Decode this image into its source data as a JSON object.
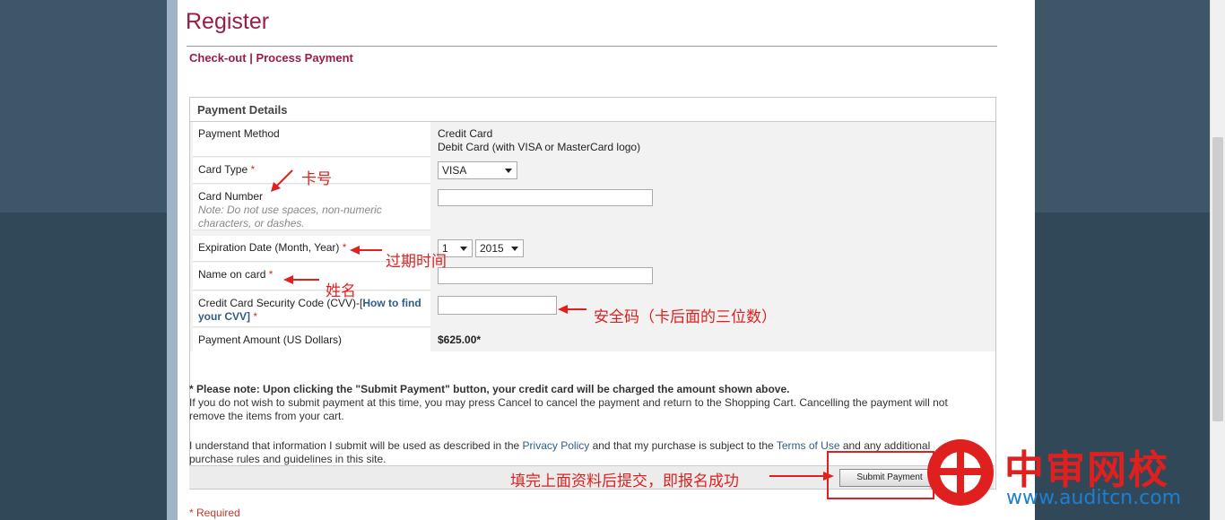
{
  "page": {
    "title": "Register",
    "breadcrumb": {
      "checkout": "Check-out",
      "separator": "|",
      "process": "Process Payment"
    }
  },
  "panel": {
    "heading": "Payment Details",
    "payment_method": {
      "label": "Payment Method",
      "options": [
        "Credit Card",
        "Debit Card (with VISA or MasterCard logo)"
      ]
    },
    "card_type": {
      "label": "Card Type",
      "required": "*",
      "selected": "VISA"
    },
    "card_number": {
      "label": "Card Number",
      "note": "Note: Do not use spaces, non-numeric characters, or dashes.",
      "value": ""
    },
    "expiration": {
      "label": "Expiration Date (Month, Year)",
      "required": "*",
      "month": "1",
      "year": "2015"
    },
    "name_on_card": {
      "label": "Name on card",
      "required": "*",
      "value": ""
    },
    "cvv": {
      "label_prefix": "Credit Card Security Code (CVV)-[",
      "link": "How to find your CVV",
      "label_suffix": "]",
      "required": "*",
      "value": ""
    },
    "amount": {
      "label": "Payment Amount (US Dollars)",
      "value": "$625.00*"
    }
  },
  "notice": {
    "bold": "* Please note: Upon clicking the \"Submit Payment\" button, your credit card will be charged the amount shown above.",
    "text": "If you do not wish to submit payment at this time, you may press Cancel to cancel the payment and return to the Shopping Cart.  Cancelling the payment will not remove the items from your cart.",
    "agree_1": "I understand that information I submit will be used as described in the ",
    "privacy_link": "Privacy Policy",
    "agree_2": " and that my purchase is subject to the ",
    "terms_link": "Terms of Use",
    "agree_3": " and any additional purchase rules and guidelines in this site."
  },
  "buttons": {
    "submit": "Submit Payment"
  },
  "required_note": "* Required",
  "annotations": {
    "card_number": "卡号",
    "expiration": "过期时间",
    "name": "姓名",
    "cvv": "安全码（卡后面的三位数）",
    "submit": "填完上面资料后提交，即报名成功"
  },
  "logo": {
    "name": "中审网校",
    "url": "www.auditcn.com"
  },
  "colors": {
    "accent": "#9b1c44",
    "annotation": "#e0201e",
    "link": "#2f5d88"
  }
}
